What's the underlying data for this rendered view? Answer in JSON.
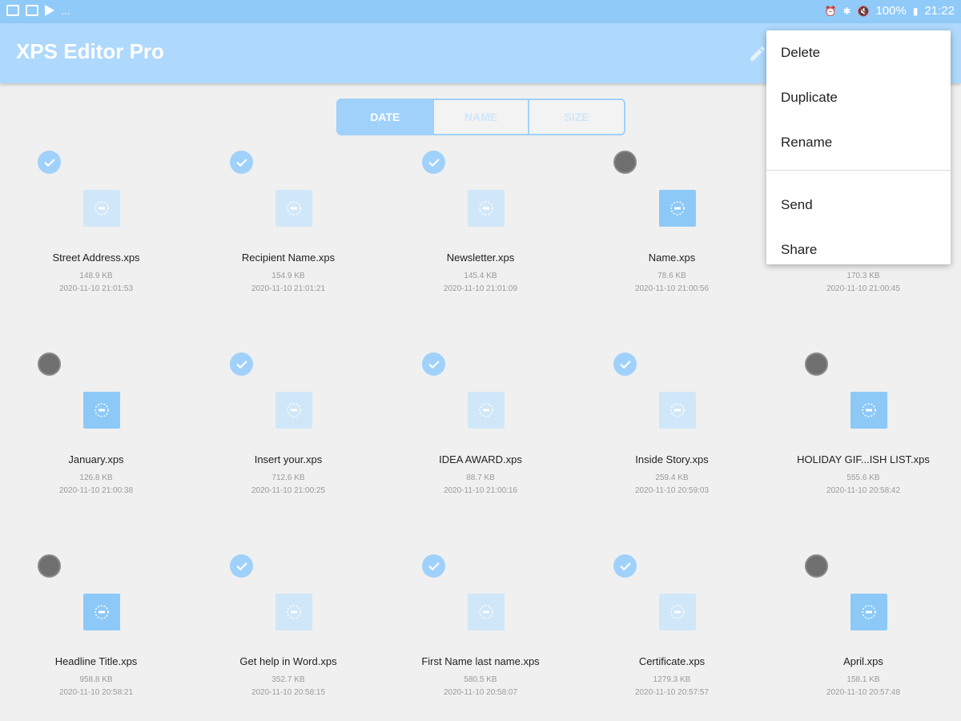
{
  "status_bar": {
    "battery": "100%",
    "time": "21:22",
    "dots": "..."
  },
  "app": {
    "title": "XPS Editor Pro"
  },
  "sort_tabs": [
    "DATE",
    "NAME",
    "SIZE"
  ],
  "files": [
    {
      "name": "Street Address.xps",
      "size": "148.9 KB",
      "date": "2020-11-10 21:01:53",
      "selected": true
    },
    {
      "name": "Recipient Name.xps",
      "size": "154.9 KB",
      "date": "2020-11-10 21:01:21",
      "selected": true
    },
    {
      "name": "Newsletter.xps",
      "size": "145.4 KB",
      "date": "2020-11-10 21:01:09",
      "selected": true
    },
    {
      "name": "Name.xps",
      "size": "78.6 KB",
      "date": "2020-11-10 21:00:56",
      "selected": false
    },
    {
      "name": "",
      "size": "170.3 KB",
      "date": "2020-11-10 21:00:45",
      "selected": false
    },
    {
      "name": "January.xps",
      "size": "126.8 KB",
      "date": "2020-11-10 21:00:38",
      "selected": false
    },
    {
      "name": "Insert your.xps",
      "size": "712.6 KB",
      "date": "2020-11-10 21:00:25",
      "selected": true
    },
    {
      "name": "IDEA AWARD.xps",
      "size": "88.7 KB",
      "date": "2020-11-10 21:00:16",
      "selected": true
    },
    {
      "name": "Inside Story.xps",
      "size": "259.4 KB",
      "date": "2020-11-10 20:59:03",
      "selected": true
    },
    {
      "name": "HOLIDAY GIF...ISH LIST.xps",
      "size": "555.6 KB",
      "date": "2020-11-10 20:58:42",
      "selected": false
    },
    {
      "name": "Headline Title.xps",
      "size": "958.8 KB",
      "date": "2020-11-10 20:58:21",
      "selected": false
    },
    {
      "name": "Get help in Word.xps",
      "size": "352.7 KB",
      "date": "2020-11-10 20:58:15",
      "selected": true
    },
    {
      "name": "First Name last name.xps",
      "size": "580.5 KB",
      "date": "2020-11-10 20:58:07",
      "selected": true
    },
    {
      "name": "Certificate.xps",
      "size": "1279.3 KB",
      "date": "2020-11-10 20:57:57",
      "selected": true
    },
    {
      "name": "April.xps",
      "size": "158.1 KB",
      "date": "2020-11-10 20:57:48",
      "selected": false
    }
  ],
  "context_menu": {
    "delete": "Delete",
    "duplicate": "Duplicate",
    "rename": "Rename",
    "send": "Send",
    "share": "Share"
  },
  "colors": {
    "status_bar": "#90caf9",
    "app_bar": "#aed8fc",
    "accent": "#9fd1fb",
    "unselected": "#6f6f6f"
  },
  "icons": {
    "edit": "pencil-icon",
    "selected": "check-circle-icon",
    "unselected": "circle-icon",
    "file": "xps-file-icon"
  }
}
